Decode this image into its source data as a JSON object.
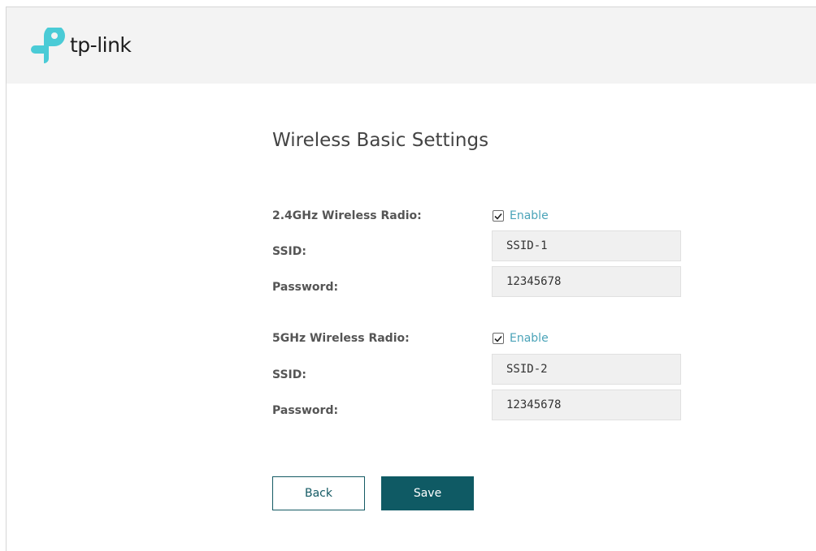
{
  "brand": {
    "name": "tp-link",
    "accent_color": "#4acbd6",
    "primary_color": "#0f5a64"
  },
  "page_title": "Wireless Basic Settings",
  "radio_24": {
    "label": "2.4GHz Wireless Radio:",
    "enabled": true,
    "enable_label": "Enable",
    "ssid_label": "SSID:",
    "ssid_value": "SSID-1",
    "password_label": "Password:",
    "password_value": "12345678"
  },
  "radio_5": {
    "label": "5GHz Wireless Radio:",
    "enabled": true,
    "enable_label": "Enable",
    "ssid_label": "SSID:",
    "ssid_value": "SSID-2",
    "password_label": "Password:",
    "password_value": "12345678"
  },
  "buttons": {
    "back_label": "Back",
    "save_label": "Save"
  }
}
